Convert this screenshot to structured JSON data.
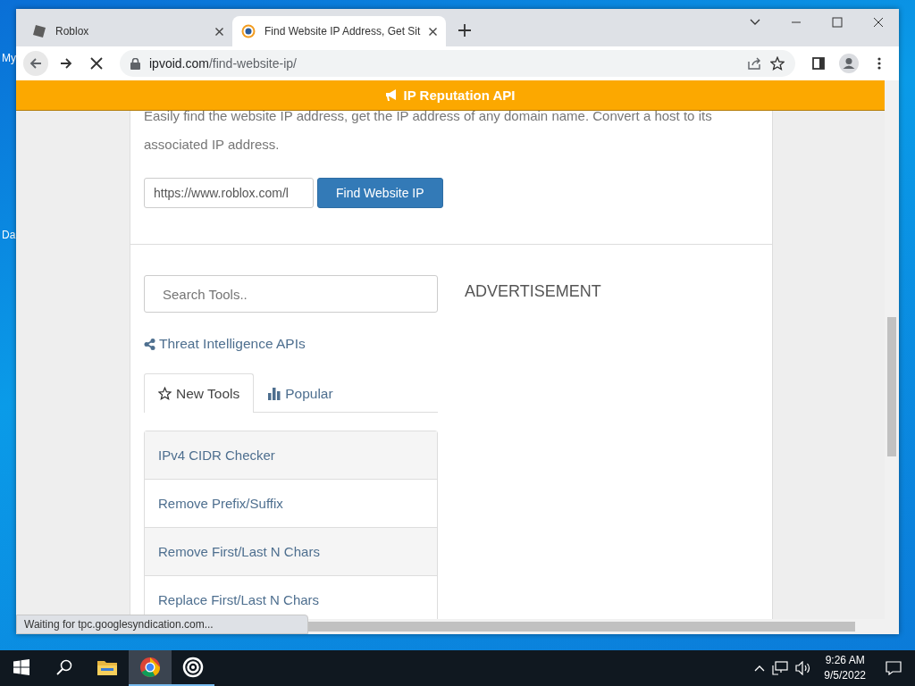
{
  "desktop_icons": [
    {
      "label": "My"
    },
    {
      "label": "Da"
    }
  ],
  "browser": {
    "tabs": [
      {
        "title": "Roblox",
        "kind": "roblox",
        "selected": false
      },
      {
        "title": "Find Website IP Address, Get Sit",
        "kind": "ipvoid",
        "selected": true
      }
    ],
    "address": {
      "host": "ipvoid.com",
      "path": "/find-website-ip/"
    },
    "loading": true
  },
  "page": {
    "banner": "IP Reputation API",
    "description": "Easily find the website IP address, get the IP address of any domain name. Convert a host to its associated IP address.",
    "url_field": {
      "value": "https://www.roblox.com/l"
    },
    "find_button": "Find Website IP",
    "search": {
      "placeholder": "Search Tools.."
    },
    "api_link": "Threat Intelligence APIs",
    "tool_tabs": [
      {
        "label": "New Tools",
        "kind": "star",
        "selected": true
      },
      {
        "label": "Popular",
        "kind": "chart",
        "selected": false
      }
    ],
    "tools": [
      "IPv4 CIDR Checker",
      "Remove Prefix/Suffix",
      "Remove First/Last N Chars",
      "Replace First/Last N Chars"
    ],
    "advertisement": "ADVERTISEMENT"
  },
  "status_bar": "Waiting for tpc.googlesyndication.com...",
  "taskbar": {
    "apps": [
      {
        "kind": "explorer",
        "selected": false,
        "running": false
      },
      {
        "kind": "chrome",
        "selected": true,
        "running": true
      },
      {
        "kind": "target",
        "selected": false,
        "running": true
      }
    ],
    "time": "9:26 AM",
    "date": "9/5/2022"
  }
}
